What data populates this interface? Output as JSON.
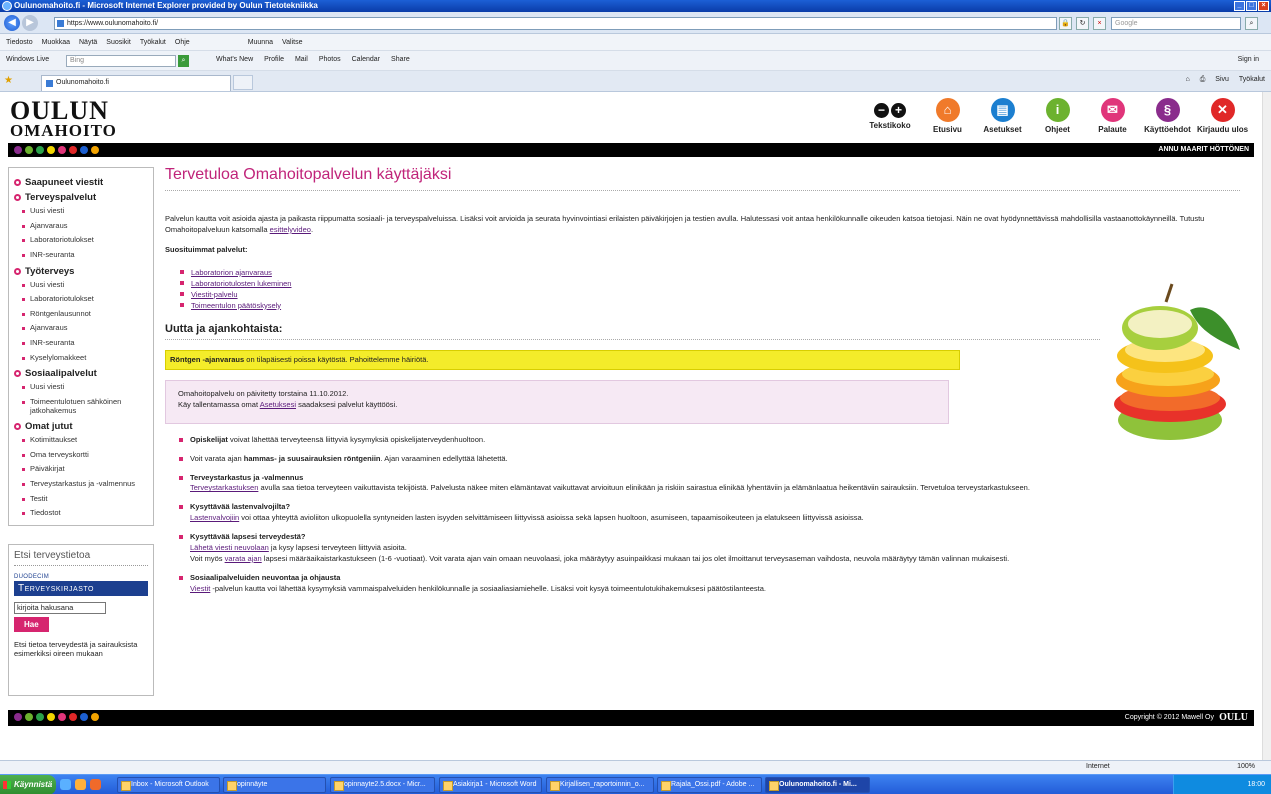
{
  "window": {
    "title": "Oulunomahoito.fi - Microsoft Internet Explorer provided by Oulun Tietotekniikka",
    "url": "https://www.oulunomahoito.fi/",
    "search_placeholder": "Google"
  },
  "menu": [
    "Tiedosto",
    "Muokkaa",
    "Näytä",
    "Suosikit",
    "Työkalut",
    "Ohje"
  ],
  "menu_extras": {
    "muunna": "Muunna",
    "valitse": "Valitse"
  },
  "windows_live": {
    "label": "Windows Live",
    "search_placeholder": "Bing",
    "links": [
      "What's New",
      "Profile",
      "Mail",
      "Photos",
      "Calendar",
      "Share"
    ],
    "signin": "Sign in"
  },
  "tab": {
    "title": "Oulunomahoito.fi"
  },
  "ie_tools": {
    "sivu": "Sivu",
    "tyokalut": "Työkalut"
  },
  "site": {
    "logo_line1": "OULUN",
    "logo_line2": "OMAHOITO",
    "user": "ANNU MAARIT HÖTTÖNEN",
    "top_icons": [
      {
        "label": "Tekstikoko",
        "color": "#111111"
      },
      {
        "label": "Etusivu",
        "color": "#f07a2a"
      },
      {
        "label": "Asetukset",
        "color": "#1c7fd0"
      },
      {
        "label": "Ohjeet",
        "color": "#6cb22f"
      },
      {
        "label": "Palaute",
        "color": "#e0357a"
      },
      {
        "label": "Käyttöehdot",
        "color": "#8a2c8c"
      },
      {
        "label": "Kirjaudu ulos",
        "color": "#e02828"
      }
    ],
    "dot_colors": [
      "#8b2c8e",
      "#6cb22f",
      "#2aa14a",
      "#f2d600",
      "#e0357a",
      "#e02828",
      "#1c5fd0",
      "#f2a300"
    ]
  },
  "sidebar": {
    "sections": [
      {
        "title": "Saapuneet viestit",
        "items": []
      },
      {
        "title": "Terveyspalvelut",
        "items": [
          "Uusi viesti",
          "Ajanvaraus",
          "Laboratoriotulokset",
          "INR-seuranta"
        ]
      },
      {
        "title": "Työterveys",
        "items": [
          "Uusi viesti",
          "Laboratoriotulokset",
          "Röntgenlausunnot",
          "Ajanvaraus",
          "INR-seuranta",
          "Kyselylomakkeet"
        ]
      },
      {
        "title": "Sosiaalipalvelut",
        "items": [
          "Uusi viesti",
          "Toimeentulotuen sähköinen jatkohakemus"
        ]
      },
      {
        "title": "Omat jutut",
        "items": [
          "Kotimittaukset",
          "Oma terveyskortti",
          "Päiväkirjat",
          "Terveystarkastus ja -valmennus",
          "Testit",
          "Tiedostot"
        ]
      }
    ]
  },
  "search_panel": {
    "heading": "Etsi terveystietoa",
    "brand_small": "DUODECIM",
    "brand": "Terveyskirjasto",
    "input_value": "kirjoita hakusana",
    "button": "Hae",
    "help": "Etsi tietoa terveydestä ja sairauksista esimerkiksi oireen mukaan"
  },
  "main": {
    "title": "Tervetuloa Omahoitopalvelun käyttäjäksi",
    "intro_1": "Palvelun kautta voit asioida ajasta ja paikasta riippumatta sosiaali- ja terveyspalveluissa. Lisäksi voit arvioida ja seurata hyvinvointiasi erilaisten päiväkirjojen ja testien avulla. Halutessasi voit antaa henkilökunnalle oikeuden katsoa tietojasi. Näin ne ovat hyödynnettävissä mahdollisilla vastaanottokäynneillä. Tutustu Omahoitopalveluun katsomalla ",
    "intro_link": "esittelyvideo",
    "intro_end": ".",
    "favorites_heading": "Suosituimmat palvelut:",
    "favorites": [
      "Laboratorion ajanvaraus",
      "Laboratoriotulosten lukeminen",
      "Viestit-palvelu",
      "Toimeentulon päätöskysely"
    ],
    "news_heading": "Uutta ja ajankohtaista:",
    "notice_yellow_bold": "Röntgen -ajanvaraus",
    "notice_yellow_rest": " on tilapäisesti poissa käytöstä. Pahoittelemme häiriötä.",
    "notice_pink_line1": "Omahoitopalvelu on päivitetty torstaina 11.10.2012.",
    "notice_pink_pre": "Käy tallentamassa omat ",
    "notice_pink_link": "Asetuksesi",
    "notice_pink_post": " saadaksesi palvelut käyttöösi.",
    "news": {
      "n1_bold": "Opiskelijat",
      "n1_rest": " voivat lähettää terveyteensä liittyviä kysymyksiä opiskelijaterveydenhuoltoon.",
      "n2_pre": "Voit varata ajan ",
      "n2_bold": "hammas- ja suusairauksien röntgeniin",
      "n2_rest": ". Ajan varaaminen edellyttää lähetettä.",
      "n3_title": "Terveystarkastus ja -valmennus",
      "n3_link": "Terveystarkastuksen",
      "n3_rest": " avulla saa tietoa terveyteen vaikuttavista tekijöistä. Palvelusta näkee miten elämäntavat vaikuttavat arvioituun elinikään ja riskiin sairastua elinikää lyhentäviin ja elämänlaatua heikentäviin sairauksiin. Tervetuloa terveystarkastukseen.",
      "n4_title": "Kysyttävää lastenvalvojilta?",
      "n4_link": "Lastenvalvojiin",
      "n4_rest": " voi ottaa yhteyttä avioliiton ulkopuolella syntyneiden lasten isyyden selvittämiseen liittyvissä asioissa sekä lapsen huoltoon, asumiseen, tapaamisoikeuteen ja elatukseen liittyvissä asioissa.",
      "n5_title": "Kysyttävää lapsesi terveydestä?",
      "n5_link1": "Lähetä viesti neuvolaan",
      "n5_mid1": " ja kysy lapsesi terveyteen liittyviä asioita.",
      "n5_pre2": "Voit myös ",
      "n5_link2": "varata ajan",
      "n5_rest2": " lapsesi määräaikaistarkastukseen (1-6 -vuotiaat). Voit varata ajan vain omaan neuvolaasi, joka määräytyy asuinpaikkasi mukaan tai jos olet ilmoittanut terveysaseman vaihdosta, neuvola määräytyy tämän valinnan mukaisesti.",
      "n6_title": "Sosiaalipalveluiden neuvontaa ja ohjausta",
      "n6_link": "Viestit",
      "n6_rest": " -palvelun kautta voi lähettää kysymyksiä vammaispalveluiden henkilökunnalle ja sosiaaliasiamiehelle. Lisäksi voit kysyä toimeentulotukihakemuksesi päätöstilanteesta."
    }
  },
  "footer": {
    "copyright": "Copyright © 2012 Mawell Oy",
    "brand": "OULU"
  },
  "statusbar": {
    "zone": "Internet",
    "zoom": "100%"
  },
  "taskbar": {
    "start": "Käynnistä",
    "buttons": [
      "Inbox - Microsoft Outlook",
      "opinnäyte",
      "opinnayte2.5.docx - Micr...",
      "Asiakirja1 - Microsoft Word",
      "Kirjallisen_raportoinnin_o...",
      "Rajala_Ossi.pdf - Adobe ...",
      "Oulunomahoito.fi - Mi..."
    ],
    "clock": "18:00"
  }
}
